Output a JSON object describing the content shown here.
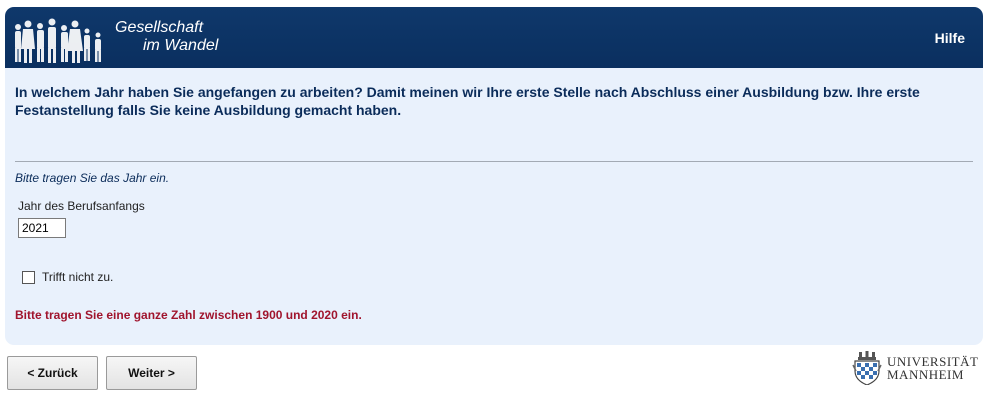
{
  "header": {
    "logo_line1": "Gesellschaft",
    "logo_line2": "im Wandel",
    "help_label": "Hilfe",
    "bg_color": "#0f386b"
  },
  "question": {
    "text": "In welchem Jahr haben Sie angefangen zu arbeiten? Damit meinen wir Ihre erste Stelle nach Abschluss einer Ausbildung bzw. Ihre erste Festanstellung falls Sie keine Ausbildung gemacht haben."
  },
  "form": {
    "instruction": "Bitte tragen Sie das Jahr ein.",
    "year_label": "Jahr des Berufsanfangs",
    "year_value": "2021",
    "not_applicable_label": "Trifft nicht zu.",
    "not_applicable_checked": false,
    "error_message": "Bitte tragen Sie eine ganze Zahl zwischen 1900 und 2020 ein.",
    "error_color": "#a0142d"
  },
  "navigation": {
    "back_label": "< Zurück",
    "next_label": "Weiter >"
  },
  "footer": {
    "university_line1": "UNIVERSITÄT",
    "university_line2": "MANNHEIM"
  }
}
